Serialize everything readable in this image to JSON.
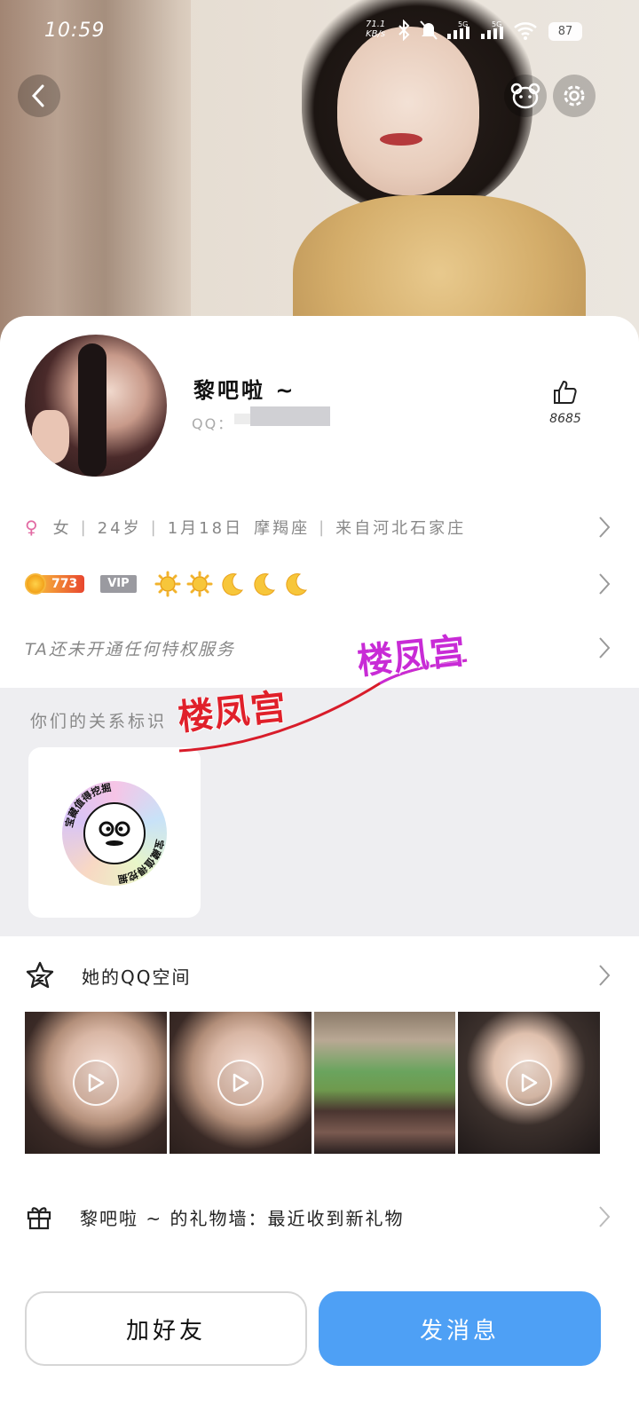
{
  "status_bar": {
    "time": "10:59",
    "net_speed": "71.1",
    "net_unit": "KB/s",
    "battery": "87"
  },
  "profile": {
    "nickname": "黎吧啦 ~",
    "qq_label": "QQ：",
    "like_count": "8685"
  },
  "info": {
    "gender": "女",
    "age": "24岁",
    "birthday": "1月18日",
    "zodiac": "摩羯座",
    "hometown": "来自河北石家庄"
  },
  "level": {
    "coin_value": "773",
    "vip_label": "VIP",
    "icons": [
      "sun-icon",
      "sun-icon",
      "moon-icon",
      "moon-icon",
      "moon-icon"
    ]
  },
  "privilege": {
    "text": "TA还未开通任何特权服务"
  },
  "relationship": {
    "title": "你们的关系标识",
    "badge_text": "宝藏值得挖掘"
  },
  "watermark": {
    "text1": "楼凤宫",
    "text2": "楼凤宫"
  },
  "qzone": {
    "label": "她的QQ空间",
    "thumbnails": [
      {
        "kind": "video"
      },
      {
        "kind": "video"
      },
      {
        "kind": "photo"
      },
      {
        "kind": "video"
      }
    ]
  },
  "gift_wall": {
    "label": "黎吧啦 ~ 的礼物墙：最近收到新礼物"
  },
  "actions": {
    "add_friend": "加好友",
    "send_message": "发消息"
  },
  "colors": {
    "primary": "#4ea0f5",
    "gender": "#e26aa3",
    "watermark_red": "#e0202a",
    "watermark_purple": "#c82bd6"
  }
}
